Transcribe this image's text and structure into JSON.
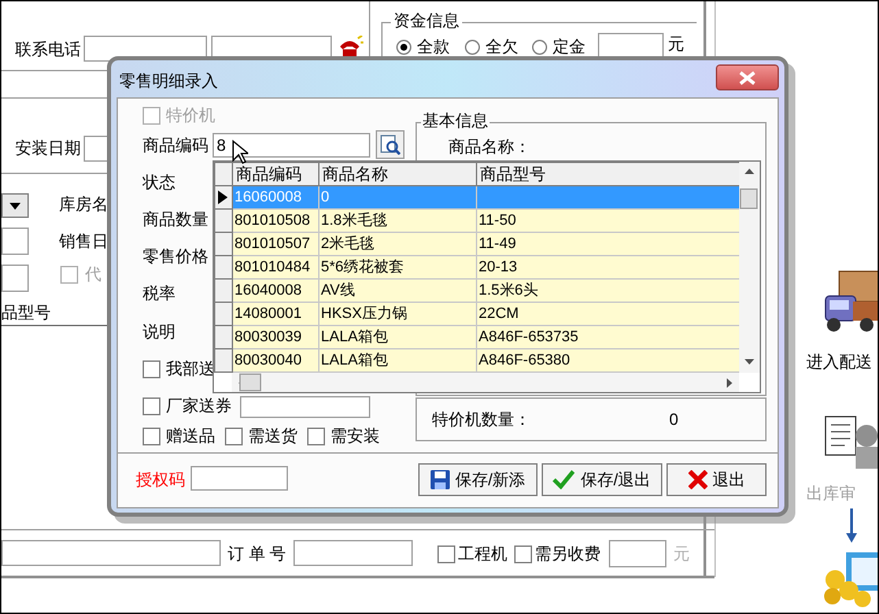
{
  "main_form": {
    "phone_label": "联系电话",
    "funds_group": {
      "title": "资金信息",
      "options": [
        {
          "label": "全款",
          "selected": true
        },
        {
          "label": "全欠",
          "selected": false
        },
        {
          "label": "定金",
          "selected": false
        }
      ],
      "unit": "元"
    },
    "install_date_label": "安装日期",
    "warehouse_label": "库房名",
    "sale_date_label": "销售日",
    "consign_checkbox": {
      "label": "代",
      "checked": false,
      "disabled": true
    },
    "table_header": "品型号",
    "order_label": "订 单 号",
    "checkboxes": [
      {
        "label": "工程机",
        "checked": false
      },
      {
        "label": "需另收费",
        "checked": false
      }
    ],
    "fee_unit": {
      "text": "元",
      "disabled": true
    }
  },
  "side_actions": [
    {
      "kind": "delivery",
      "label": "进入配送",
      "disabled": false
    },
    {
      "kind": "audit",
      "label": "出库审",
      "disabled": true
    }
  ],
  "dialog": {
    "title": "零售明细录入",
    "special_checkbox": {
      "label": "特价机",
      "checked": false,
      "disabled": true
    },
    "code_field": {
      "label": "商品编码",
      "value": "8"
    },
    "labels": [
      "状态",
      "商品数量",
      "零售价格",
      "税率",
      "说明"
    ],
    "self_delivery": {
      "label": "我部送",
      "checked": false
    },
    "vendor_coupon": {
      "label": "厂家送券",
      "checked": false
    },
    "flags": [
      {
        "label": "赠送品",
        "checked": false
      },
      {
        "label": "需送货",
        "checked": false
      },
      {
        "label": "需安装",
        "checked": false
      }
    ],
    "info_group": {
      "title": "基本信息",
      "name_label": "商品名称：",
      "special_count_label": "特价机数量：",
      "special_count": "0"
    },
    "grid": {
      "columns": [
        "商品编码",
        "商品名称",
        "商品型号"
      ],
      "rows": [
        {
          "code": "16060008",
          "name": "0",
          "selected": true
        },
        {
          "code": "801010508",
          "name": "1.8米毛毯",
          "model": "11-50",
          "selected": false
        },
        {
          "code": "801010507",
          "name": "2米毛毯",
          "model": "11-49",
          "selected": false
        },
        {
          "code": "801010484",
          "name": "5*6绣花被套",
          "model": "20-13",
          "selected": false
        },
        {
          "code": "16040008",
          "name": "AV线",
          "model": "1.5米6头",
          "selected": false
        },
        {
          "code": "14080001",
          "name": "HKSX压力锅",
          "model": "22CM",
          "selected": false
        },
        {
          "code": "80030039",
          "name": "LALA箱包",
          "model": "A846F-653735",
          "selected": false
        },
        {
          "code": "80030040",
          "name": "LALA箱包",
          "model": "A846F-65380",
          "selected": false
        }
      ]
    },
    "auth_label": "授权码",
    "buttons": [
      {
        "kind": "save-new",
        "label": "保存/新添"
      },
      {
        "kind": "save-exit",
        "label": "保存/退出"
      },
      {
        "kind": "exit",
        "label": "退出"
      }
    ]
  }
}
